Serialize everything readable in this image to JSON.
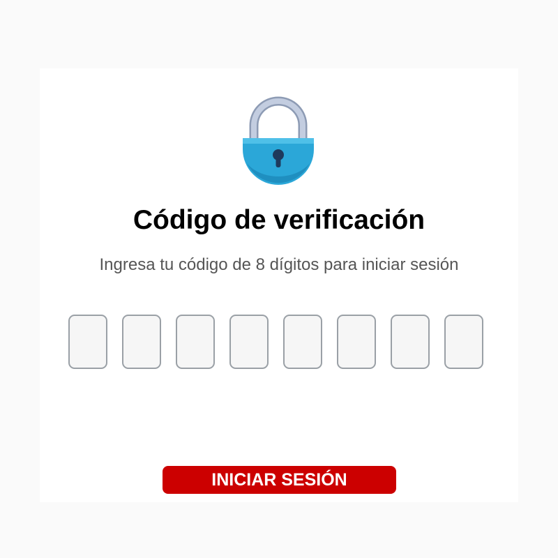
{
  "title": "Código de verificación",
  "subtitle": "Ingresa tu código de 8 dígitos para iniciar sesión",
  "code": {
    "digit_count": 8,
    "values": [
      "",
      "",
      "",
      "",
      "",
      "",
      "",
      ""
    ]
  },
  "login_button": {
    "label": "INICIAR SESIÓN"
  },
  "icons": {
    "lock": "padlock-icon"
  },
  "colors": {
    "page_background": "#fafafa",
    "card_background": "#ffffff",
    "button": "#cc0000",
    "button_text": "#ffffff",
    "lock_body": "#2ba7d8",
    "lock_shackle": "#b7c3d8",
    "keyhole": "#1e3a5c",
    "box_border": "#9aa0a6"
  }
}
